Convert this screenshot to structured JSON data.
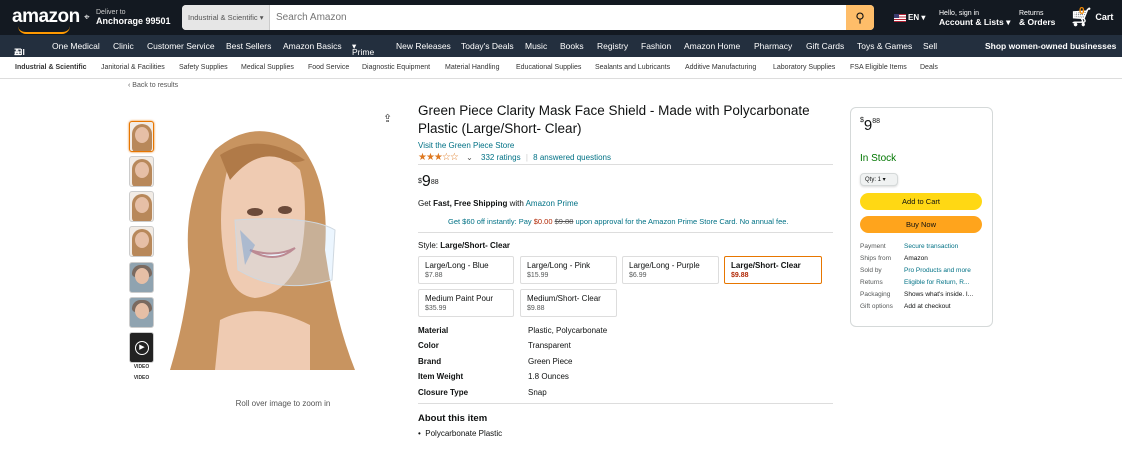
{
  "header": {
    "logo": "amazon",
    "deliver_line1": "Deliver to",
    "deliver_line2": "Anchorage 99501",
    "search_category": "Industrial & Scientific",
    "search_placeholder": "Search Amazon",
    "lang": "EN",
    "account_line1": "Hello, sign in",
    "account_line2": "Account & Lists",
    "returns_line1": "Returns",
    "returns_line2": "& Orders",
    "cart_count": "0",
    "cart_label": "Cart"
  },
  "nav": {
    "items": [
      "All",
      "One Medical",
      "Clinic",
      "Customer Service",
      "Best Sellers",
      "Amazon Basics",
      "Prime",
      "New Releases",
      "Today's Deals",
      "Music",
      "Books",
      "Registry",
      "Fashion",
      "Amazon Home",
      "Pharmacy",
      "Gift Cards",
      "Toys & Games",
      "Sell"
    ],
    "promo": "Shop women-owned businesses"
  },
  "subnav": {
    "items": [
      "Industrial & Scientific",
      "Janitorial & Facilities",
      "Safety Supplies",
      "Medical Supplies",
      "Food Service",
      "Diagnostic Equipment",
      "Material Handling",
      "Educational Supplies",
      "Sealants and Lubricants",
      "Additive Manufacturing",
      "Laboratory Supplies",
      "FSA Eligible Items",
      "Deals"
    ]
  },
  "gallery": {
    "back": "‹ Back to results",
    "video_label": "VIDEO",
    "rollover": "Roll over image to zoom in"
  },
  "product": {
    "title": "Green Piece Clarity Mask Face Shield - Made with Polycarbonate Plastic (Large/Short- Clear)",
    "store": "Visit the Green Piece Store",
    "stars": "★★★☆☆",
    "rating_value": 3.5,
    "ratings": "332 ratings",
    "questions": "8 answered questions",
    "price_symbol": "$",
    "price_whole": "9",
    "price_fraction": "88",
    "shipping_pre": "Get ",
    "shipping_bold": "Fast, Free Shipping",
    "shipping_mid": " with ",
    "shipping_link": "Amazon Prime",
    "promo_a": "Get $60 off instantly: Pay ",
    "promo_red": "$0.00",
    "promo_strike": "$9.88",
    "promo_b": " upon approval for the Amazon Prime Store Card. No annual fee.",
    "style_label": "Style: ",
    "style_value": "Large/Short- Clear",
    "options": [
      {
        "name": "Large/Long - Blue",
        "price": "$7.88"
      },
      {
        "name": "Large/Long - Pink",
        "price": "$15.99"
      },
      {
        "name": "Large/Long - Purple",
        "price": "$6.99"
      },
      {
        "name": "Large/Short- Clear",
        "price": "$9.88"
      },
      {
        "name": "Medium Paint Pour",
        "price": "$35.99"
      },
      {
        "name": "Medium/Short- Clear",
        "price": "$9.88"
      }
    ],
    "specs": [
      {
        "k": "Material",
        "v": "Plastic, Polycarbonate"
      },
      {
        "k": "Color",
        "v": "Transparent"
      },
      {
        "k": "Brand",
        "v": "Green Piece"
      },
      {
        "k": "Item Weight",
        "v": "1.8 Ounces"
      },
      {
        "k": "Closure Type",
        "v": "Snap"
      }
    ],
    "about_title": "About this item",
    "bullets": [
      "Polycarbonate Plastic"
    ]
  },
  "buybox": {
    "price_symbol": "$",
    "price_whole": "9",
    "price_fraction": "88",
    "stock": "In Stock",
    "qty": "Qty: 1",
    "add_to_cart": "Add to Cart",
    "buy_now": "Buy Now",
    "rows": [
      {
        "k": "Payment",
        "v": "Secure transaction"
      },
      {
        "k": "Ships from",
        "v": "Amazon"
      },
      {
        "k": "Sold by",
        "v": "Pro Products and more"
      },
      {
        "k": "Returns",
        "v": "Eligible for Return, R..."
      },
      {
        "k": "Packaging",
        "v": "Shows what's inside. I..."
      },
      {
        "k": "Gift options",
        "v": "Add at checkout"
      }
    ]
  },
  "colors": {
    "accent": "#ff9900",
    "link": "#007185",
    "instock": "#007600",
    "price_red": "#b12704"
  }
}
